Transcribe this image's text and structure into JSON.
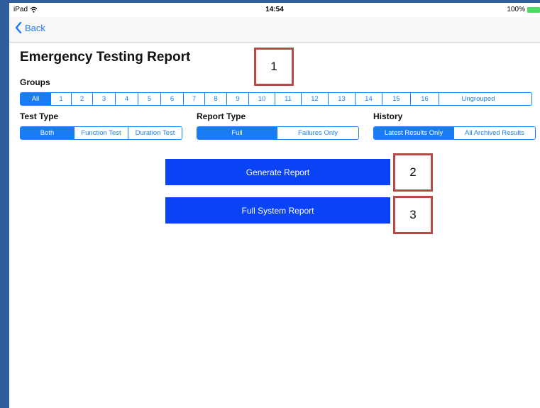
{
  "status_bar": {
    "device": "iPad",
    "time": "14:54",
    "battery": "100%"
  },
  "nav": {
    "back_label": "Back"
  },
  "page_title": "Emergency Testing Report",
  "groups": {
    "label": "Groups",
    "options": [
      "All",
      "1",
      "2",
      "3",
      "4",
      "5",
      "6",
      "7",
      "8",
      "9",
      "10",
      "11",
      "12",
      "13",
      "14",
      "15",
      "16",
      "Ungrouped"
    ],
    "selected": "All"
  },
  "test_type": {
    "label": "Test Type",
    "options": [
      "Both",
      "Function Test",
      "Duration Test"
    ],
    "selected": "Both"
  },
  "report_type": {
    "label": "Report Type",
    "options": [
      "Full",
      "Failures Only"
    ],
    "selected": "Full"
  },
  "history": {
    "label": "History",
    "options": [
      "Latest Results Only",
      "All Archived Results"
    ],
    "selected": "Latest Results Only"
  },
  "buttons": {
    "generate": "Generate Report",
    "full_system": "Full System Report"
  },
  "callouts": [
    "1",
    "2",
    "3"
  ],
  "colors": {
    "accent": "#1a7cf5",
    "button_blue": "#0a42f5",
    "callout_border": "#b54a46",
    "frame": "#2f5d9e"
  }
}
